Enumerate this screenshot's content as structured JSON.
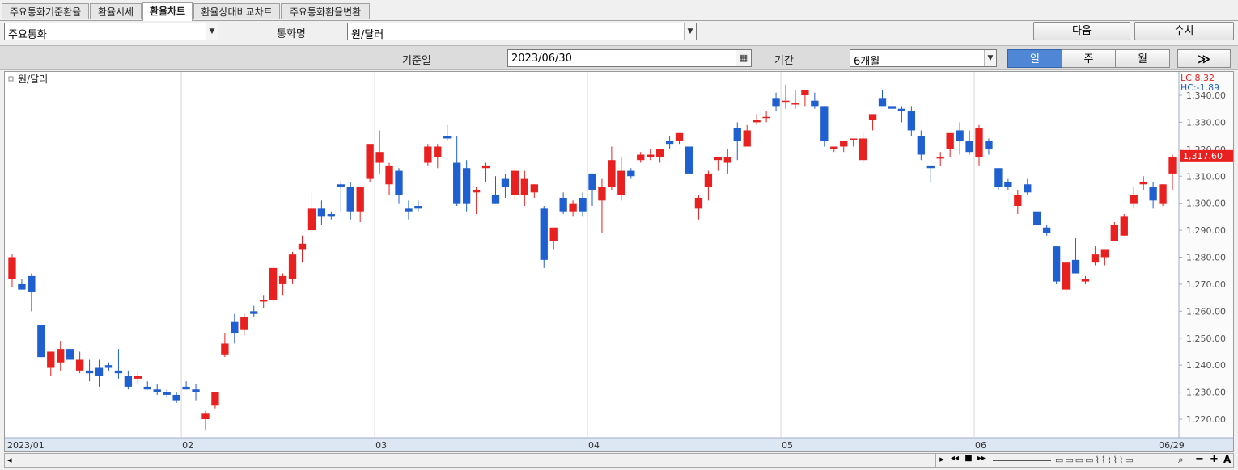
{
  "tabs": [
    {
      "label": "주요통화기준환율",
      "active": false
    },
    {
      "label": "환율시세",
      "active": false
    },
    {
      "label": "환율차트",
      "active": true
    },
    {
      "label": "환율상대비교차트",
      "active": false
    },
    {
      "label": "주요통화환율변환",
      "active": false
    }
  ],
  "controls": {
    "category_value": "주요통화",
    "currency_label": "통화명",
    "currency_value": "원/달러",
    "next_button": "다음",
    "values_button": "수치",
    "date_label": "기준일",
    "date_value": "2023/06/30",
    "period_label": "기간",
    "period_value": "6개월",
    "periodicity": [
      "일",
      "주",
      "월"
    ],
    "periodicity_selected": "일",
    "go_button": "≫"
  },
  "colors": {
    "up": "#e8201f",
    "down": "#1f5fd0",
    "accent": "#4f86d6"
  },
  "chart_data": {
    "type": "candlestick",
    "title": "원/달러",
    "lc_label": "LC:8.32",
    "hc_label": "HC:-1.89",
    "last_value_label": "1,317.60",
    "last_value": 1317.6,
    "y_ticks": [
      "1,340.00",
      "1,330.00",
      "1,320.00",
      "1,310.00",
      "1,300.00",
      "1,290.00",
      "1,280.00",
      "1,270.00",
      "1,260.00",
      "1,250.00",
      "1,240.00",
      "1,230.00",
      "1,220.00"
    ],
    "y_tick_values": [
      1340,
      1330,
      1320,
      1310,
      1300,
      1290,
      1280,
      1270,
      1260,
      1250,
      1240,
      1230,
      1220
    ],
    "x_labels": [
      {
        "label": "2023/01",
        "index": 0
      },
      {
        "label": "02",
        "index": 18
      },
      {
        "label": "03",
        "index": 38
      },
      {
        "label": "04",
        "index": 60
      },
      {
        "label": "05",
        "index": 80
      },
      {
        "label": "06",
        "index": 100
      },
      {
        "label": "06/29",
        "index": 119
      }
    ],
    "grid_x_indices": [
      18,
      38,
      60,
      80,
      100
    ],
    "ylim": [
      1215,
      1345
    ],
    "candles": [
      [
        1272,
        1281,
        1269,
        1280
      ],
      [
        1270,
        1272,
        1268,
        1268
      ],
      [
        1273,
        1274,
        1260,
        1267
      ],
      [
        1255,
        1255,
        1243,
        1243
      ],
      [
        1239,
        1245,
        1236,
        1245
      ],
      [
        1241,
        1249,
        1238,
        1246
      ],
      [
        1246,
        1246,
        1242,
        1242
      ],
      [
        1238,
        1245,
        1237,
        1242
      ],
      [
        1238,
        1242,
        1234,
        1237
      ],
      [
        1239,
        1242,
        1232,
        1236
      ],
      [
        1240,
        1241,
        1238,
        1239
      ],
      [
        1238,
        1246,
        1235,
        1237
      ],
      [
        1236,
        1238,
        1231,
        1232
      ],
      [
        1235,
        1238,
        1233,
        1236
      ],
      [
        1232,
        1234,
        1231,
        1231
      ],
      [
        1231,
        1233,
        1229,
        1230
      ],
      [
        1230,
        1231,
        1228,
        1229
      ],
      [
        1229,
        1230,
        1226,
        1227
      ],
      [
        1232,
        1234,
        1231,
        1231
      ],
      [
        1231,
        1233,
        1227,
        1230
      ],
      [
        1220,
        1223,
        1216,
        1222
      ],
      [
        1225,
        1230,
        1224,
        1230
      ],
      [
        1244,
        1252,
        1243,
        1248
      ],
      [
        1256,
        1259,
        1248,
        1252
      ],
      [
        1253,
        1259,
        1251,
        1258
      ],
      [
        1260,
        1262,
        1258,
        1259
      ],
      [
        1264,
        1266,
        1261,
        1264
      ],
      [
        1264,
        1277,
        1263,
        1276
      ],
      [
        1270,
        1274,
        1266,
        1273
      ],
      [
        1272,
        1282,
        1270,
        1281
      ],
      [
        1283,
        1288,
        1278,
        1285
      ],
      [
        1290,
        1304,
        1289,
        1298
      ],
      [
        1298,
        1301,
        1292,
        1295
      ],
      [
        1296,
        1297,
        1294,
        1295
      ],
      [
        1307,
        1308,
        1297,
        1306
      ],
      [
        1306,
        1308,
        1294,
        1297
      ],
      [
        1297,
        1306,
        1293,
        1306
      ],
      [
        1309,
        1321,
        1308,
        1322
      ],
      [
        1315,
        1327,
        1311,
        1319
      ],
      [
        1307,
        1315,
        1303,
        1314
      ],
      [
        1312,
        1313,
        1300,
        1303
      ],
      [
        1298,
        1301,
        1294,
        1297
      ],
      [
        1299,
        1301,
        1297,
        1298
      ],
      [
        1315,
        1322,
        1314,
        1321
      ],
      [
        1317,
        1322,
        1313,
        1321
      ],
      [
        1325,
        1329,
        1323,
        1324
      ],
      [
        1315,
        1325,
        1299,
        1300
      ],
      [
        1313,
        1316,
        1297,
        1300
      ],
      [
        1304,
        1306,
        1296,
        1305
      ],
      [
        1313,
        1315,
        1308,
        1314
      ],
      [
        1303,
        1310,
        1300,
        1300
      ],
      [
        1309,
        1311,
        1302,
        1306
      ],
      [
        1303,
        1313,
        1301,
        1312
      ],
      [
        1303,
        1312,
        1299,
        1309
      ],
      [
        1304,
        1307,
        1302,
        1307
      ],
      [
        1298,
        1299,
        1276,
        1279
      ],
      [
        1286,
        1291,
        1283,
        1291
      ],
      [
        1302,
        1304,
        1296,
        1297
      ],
      [
        1297,
        1301,
        1295,
        1300
      ],
      [
        1302,
        1304,
        1295,
        1297
      ],
      [
        1311,
        1311,
        1299,
        1305
      ],
      [
        1301,
        1309,
        1289,
        1306
      ],
      [
        1306,
        1321,
        1305,
        1316
      ],
      [
        1303,
        1317,
        1301,
        1312
      ],
      [
        1312,
        1313,
        1309,
        1310
      ],
      [
        1316,
        1319,
        1315,
        1318
      ],
      [
        1317,
        1320,
        1316,
        1318
      ],
      [
        1317,
        1320,
        1315,
        1320
      ],
      [
        1323,
        1325,
        1320,
        1322
      ],
      [
        1323,
        1326,
        1322,
        1326
      ],
      [
        1321,
        1321,
        1307,
        1311
      ],
      [
        1298,
        1303,
        1294,
        1302
      ],
      [
        1306,
        1312,
        1301,
        1311
      ],
      [
        1316,
        1316,
        1312,
        1317
      ],
      [
        1315,
        1320,
        1311,
        1317
      ],
      [
        1328,
        1330,
        1316,
        1323
      ],
      [
        1321,
        1329,
        1321,
        1327
      ],
      [
        1330,
        1333,
        1329,
        1331
      ],
      [
        1332,
        1334,
        1330,
        1332
      ],
      [
        1339,
        1341,
        1334,
        1336
      ],
      [
        1338,
        1344,
        1335,
        1338
      ],
      [
        1337,
        1342,
        1335,
        1337
      ],
      [
        1340,
        1341,
        1336,
        1342
      ],
      [
        1338,
        1341,
        1335,
        1336
      ],
      [
        1336,
        1336,
        1321,
        1323
      ],
      [
        1320,
        1320,
        1319,
        1321
      ],
      [
        1321,
        1321,
        1319,
        1323
      ],
      [
        1324,
        1324,
        1321,
        1324
      ],
      [
        1316,
        1326,
        1315,
        1324
      ],
      [
        1331,
        1333,
        1327,
        1333
      ],
      [
        1339,
        1342,
        1337,
        1336
      ],
      [
        1336,
        1342,
        1334,
        1335
      ],
      [
        1335,
        1336,
        1330,
        1334
      ],
      [
        1334,
        1336,
        1325,
        1327
      ],
      [
        1325,
        1327,
        1316,
        1318
      ],
      [
        1314,
        1314,
        1308,
        1313
      ],
      [
        1317,
        1319,
        1314,
        1317
      ],
      [
        1320,
        1324,
        1317,
        1326
      ],
      [
        1327,
        1330,
        1318,
        1323
      ],
      [
        1323,
        1327,
        1318,
        1319
      ],
      [
        1317,
        1329,
        1314,
        1328
      ],
      [
        1323,
        1324,
        1318,
        1320
      ],
      [
        1313,
        1313,
        1305,
        1306
      ],
      [
        1308,
        1309,
        1305,
        1306
      ],
      [
        1299,
        1305,
        1296,
        1303
      ],
      [
        1307,
        1309,
        1303,
        1304
      ],
      [
        1297,
        1297,
        1292,
        1292
      ],
      [
        1291,
        1292,
        1288,
        1289
      ],
      [
        1284,
        1284,
        1270,
        1271
      ],
      [
        1268,
        1272,
        1266,
        1278
      ],
      [
        1279,
        1287,
        1274,
        1274
      ],
      [
        1271,
        1273,
        1270,
        1272
      ],
      [
        1278,
        1284,
        1277,
        1281
      ],
      [
        1280,
        1283,
        1277,
        1283
      ],
      [
        1286,
        1293,
        1286,
        1292
      ],
      [
        1288,
        1296,
        1288,
        1295
      ],
      [
        1300,
        1306,
        1298,
        1303
      ],
      [
        1307,
        1310,
        1305,
        1308
      ],
      [
        1306,
        1308,
        1298,
        1301
      ],
      [
        1300,
        1307,
        1299,
        1307
      ],
      [
        1311,
        1318,
        1305,
        1317
      ]
    ]
  },
  "scroll": {
    "left_arrow": "◂",
    "right_arrow": "▸",
    "first": "◂◂",
    "stop": "■",
    "last": "▸▸",
    "zoom_out": "−",
    "zoom_in": "+",
    "font_label": "A"
  }
}
